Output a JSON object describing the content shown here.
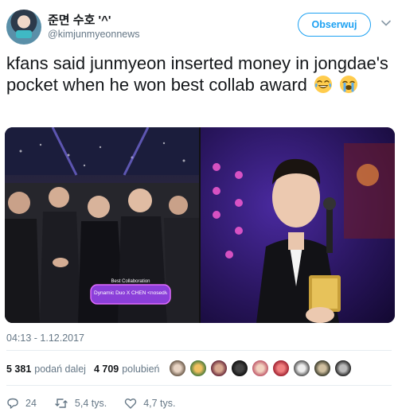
{
  "user": {
    "display_name": "준면 수호 '^'",
    "handle": "@kimjunmyeonnews",
    "avatar_icon": "profile-avatar"
  },
  "follow_button": {
    "label": "Obserwuj"
  },
  "tweet": {
    "text": "kfans said junmyeon inserted money in jongdae's pocket when he won best collab award",
    "emoji": [
      "face-with-tears-of-joy",
      "loudly-crying-face"
    ]
  },
  "media": {
    "left_overlay_title": "Best Collaboration",
    "left_overlay_text": "Dynamic Duo X CHEN <nosedive>"
  },
  "timestamp": "04:13 - 1.12.2017",
  "stats": {
    "retweets_count": "5 381",
    "retweets_label": "podań dalej",
    "likes_count": "4 709",
    "likes_label": "polubień"
  },
  "actions": {
    "replies": "24",
    "retweets": "5,4 tys.",
    "likes": "4,7 tys."
  },
  "colors": {
    "accent": "#1da1f2",
    "text": "#14171a",
    "muted": "#657786"
  }
}
